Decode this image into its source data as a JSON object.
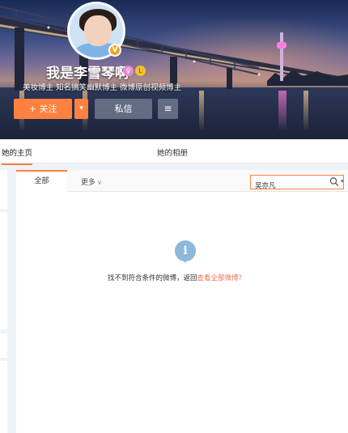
{
  "profile": {
    "name": "我是李雪琴啊",
    "bio": "美妆博主 知名搞笑幽默博主 微博原创视频博主",
    "female_icon": "♀",
    "level_icon": "L",
    "verified_icon": "V"
  },
  "actions": {
    "follow": "+ 关注",
    "follow_more": "▾",
    "message": "私信",
    "menu": "≡"
  },
  "tabs": {
    "home": "她的主页",
    "album": "她的相册"
  },
  "filter": {
    "all": "全部",
    "more": "更多",
    "more_chevron": "∨",
    "search_value": "吴亦凡",
    "search_dropdown": "▾"
  },
  "empty_state": {
    "icon": "i",
    "message": "找不到符合条件的微博，返回",
    "link": "查看全部微博？"
  },
  "colors": {
    "accent": "#ff8140",
    "link": "#eb7350",
    "info": "#8cb8da"
  },
  "icons": [
    "info-icon",
    "search-icon",
    "menu-icon",
    "female-icon",
    "level-icon",
    "verified-icon"
  ]
}
